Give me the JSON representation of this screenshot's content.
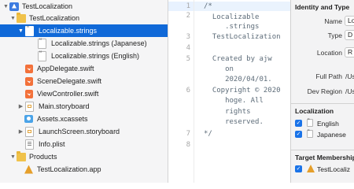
{
  "navigator": {
    "items": [
      {
        "label": "TestLocalization",
        "icon": "project-icon"
      },
      {
        "label": "TestLocalization",
        "icon": "folder-icon"
      },
      {
        "label": "Localizable.strings",
        "icon": "strings-file-icon"
      },
      {
        "label": "Localizable.strings (Japanese)",
        "icon": "strings-file-icon"
      },
      {
        "label": "Localizable.strings (English)",
        "icon": "strings-file-icon"
      },
      {
        "label": "AppDelegate.swift",
        "icon": "swift-file-icon"
      },
      {
        "label": "SceneDelegate.swift",
        "icon": "swift-file-icon"
      },
      {
        "label": "ViewController.swift",
        "icon": "swift-file-icon"
      },
      {
        "label": "Main.storyboard",
        "icon": "storyboard-file-icon"
      },
      {
        "label": "Assets.xcassets",
        "icon": "assets-icon"
      },
      {
        "label": "LaunchScreen.storyboard",
        "icon": "storyboard-file-icon"
      },
      {
        "label": "Info.plist",
        "icon": "plist-file-icon"
      },
      {
        "label": "Products",
        "icon": "folder-icon"
      },
      {
        "label": "TestLocalization.app",
        "icon": "app-icon"
      }
    ],
    "selected_color": "#1069d8"
  },
  "editor": {
    "line_numbers": [
      "1",
      "2",
      "3",
      "4",
      "5",
      "6",
      "7",
      "8"
    ],
    "lines": [
      "/*",
      "  Localizable",
      "     .strings",
      "  TestLocalization",
      "",
      "  Created by ajw",
      "     on",
      "     2020/04/01.",
      "  Copyright © 2020",
      "     hoge. All",
      "     rights",
      "     reserved.",
      "*/"
    ],
    "comment_color": "#5d6c79"
  },
  "inspector": {
    "identity_title": "Identity and Type",
    "name_label": "Name",
    "name_value": "Lo",
    "type_label": "Type",
    "type_value": "D",
    "location_label": "Location",
    "location_value": "R",
    "full_path_label": "Full Path",
    "full_path_value": "/Us",
    "dev_region_label": "Dev Region",
    "dev_region_value": "/Us",
    "localization_title": "Localization",
    "localizations": [
      "English",
      "Japanese"
    ],
    "target_title": "Target Membership",
    "target_value": "TestLocaliz",
    "checkbox_color": "#1a73e8"
  }
}
